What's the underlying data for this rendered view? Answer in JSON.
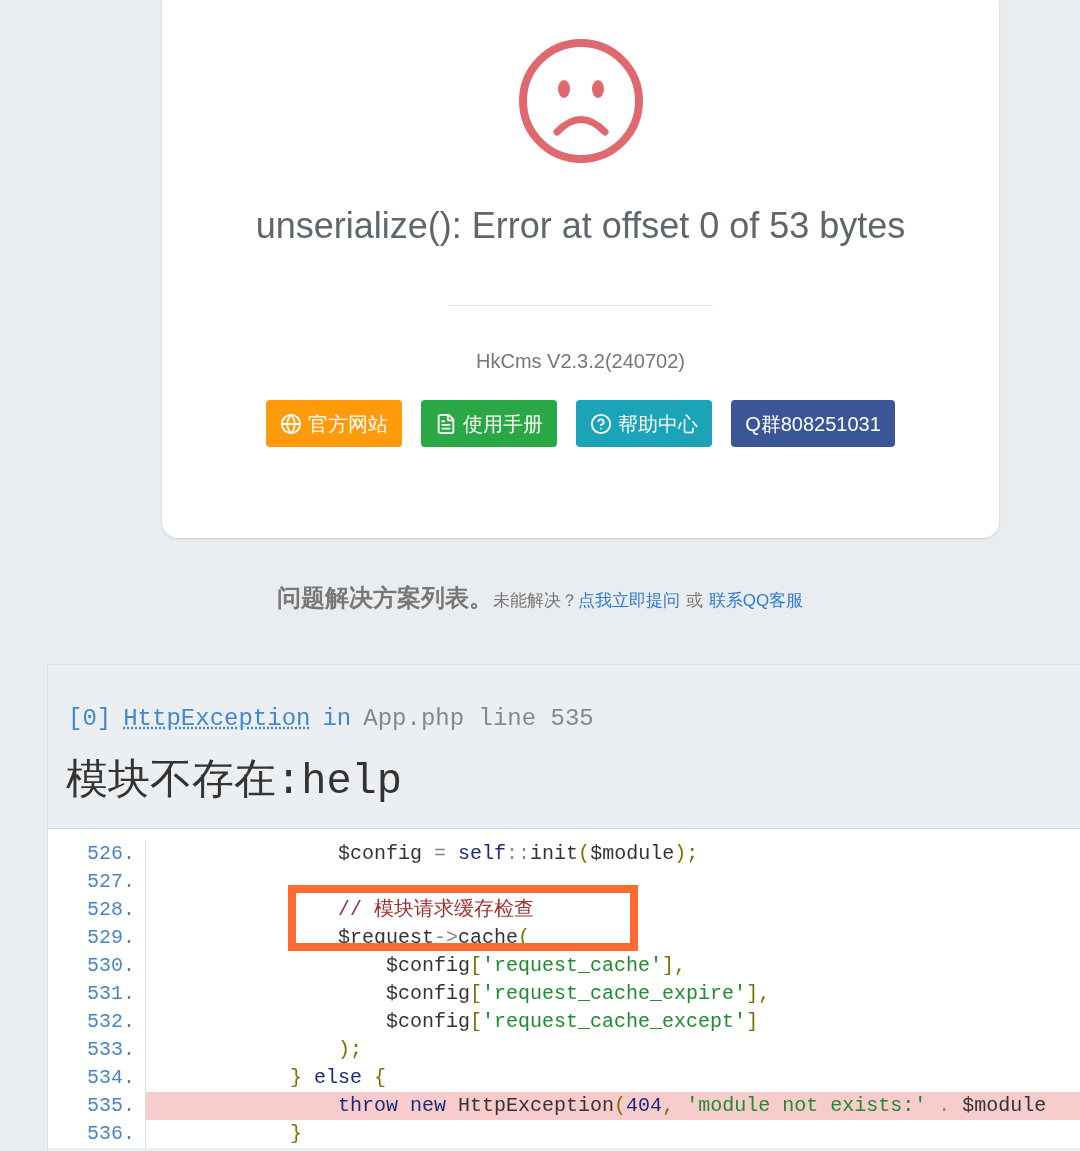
{
  "error_card": {
    "message": "unserialize(): Error at offset 0 of 53 bytes",
    "version": "HkCms V2.3.2(240702)",
    "buttons": [
      {
        "label": "官方网站",
        "kind": "globe",
        "color": "#ff9a0a"
      },
      {
        "label": "使用手册",
        "kind": "document",
        "color": "#2aa845"
      },
      {
        "label": "帮助中心",
        "kind": "help",
        "color": "#1ba3b8"
      },
      {
        "label": "Q群808251031",
        "kind": "plain",
        "color": "#3a5696"
      }
    ]
  },
  "help_line": {
    "title": "问题解决方案列表。",
    "question": "未能解决？",
    "ask_link": "点我立即提问",
    "or": "或",
    "contact_link": "联系QQ客服"
  },
  "exception": {
    "index": "[0]",
    "class": "HttpException",
    "in": "in",
    "location": "App.php line 535",
    "message": "模块不存在:help",
    "lines": [
      {
        "number": "526.",
        "highlighted": false,
        "tokens": [
          {
            "kind": "var",
            "text": "                $config"
          },
          {
            "kind": "op",
            "text": " = "
          },
          {
            "kind": "kw",
            "text": "self"
          },
          {
            "kind": "op",
            "text": "::"
          },
          {
            "kind": "fn",
            "text": "init"
          },
          {
            "kind": "punct",
            "text": "("
          },
          {
            "kind": "var",
            "text": "$module"
          },
          {
            "kind": "punct",
            "text": ");"
          }
        ]
      },
      {
        "number": "527.",
        "highlighted": false
      },
      {
        "number": "528.",
        "highlighted": false,
        "tokens": [
          {
            "kind": "cmt",
            "text": "                // 模块请求缓存检查"
          }
        ]
      },
      {
        "number": "529.",
        "highlighted": false,
        "tokens": [
          {
            "kind": "var",
            "text": "                $request"
          },
          {
            "kind": "op",
            "text": "->"
          },
          {
            "kind": "fn",
            "text": "cache"
          },
          {
            "kind": "punct",
            "text": "("
          }
        ]
      },
      {
        "number": "530.",
        "highlighted": false,
        "tokens": [
          {
            "kind": "var",
            "text": "                    $config"
          },
          {
            "kind": "punct",
            "text": "["
          },
          {
            "kind": "str",
            "text": "'request_cache'"
          },
          {
            "kind": "punct",
            "text": "],"
          }
        ]
      },
      {
        "number": "531.",
        "highlighted": false,
        "tokens": [
          {
            "kind": "var",
            "text": "                    $config"
          },
          {
            "kind": "punct",
            "text": "["
          },
          {
            "kind": "str",
            "text": "'request_cache_expire'"
          },
          {
            "kind": "punct",
            "text": "],"
          }
        ]
      },
      {
        "number": "532.",
        "highlighted": false,
        "tokens": [
          {
            "kind": "var",
            "text": "                    $config"
          },
          {
            "kind": "punct",
            "text": "["
          },
          {
            "kind": "str",
            "text": "'request_cache_except'"
          },
          {
            "kind": "punct",
            "text": "]"
          }
        ]
      },
      {
        "number": "533.",
        "highlighted": false,
        "tokens": [
          {
            "kind": "punct",
            "text": "                );"
          }
        ]
      },
      {
        "number": "534.",
        "highlighted": false,
        "tokens": [
          {
            "kind": "punct",
            "text": "            }"
          },
          {
            "kind": "kw",
            "text": " else "
          },
          {
            "kind": "punct",
            "text": "{"
          }
        ]
      },
      {
        "number": "535.",
        "highlighted": true,
        "tokens": [
          {
            "kind": "kw",
            "text": "                throw new "
          },
          {
            "kind": "fn",
            "text": "HttpException"
          },
          {
            "kind": "punct",
            "text": "("
          },
          {
            "kind": "num",
            "text": "404"
          },
          {
            "kind": "punct",
            "text": ", "
          },
          {
            "kind": "str",
            "text": "'module not exists:'"
          },
          {
            "kind": "op",
            "text": " . "
          },
          {
            "kind": "var",
            "text": "$module"
          }
        ]
      },
      {
        "number": "536.",
        "highlighted": false,
        "tokens": [
          {
            "kind": "punct",
            "text": "            }"
          }
        ]
      }
    ]
  }
}
